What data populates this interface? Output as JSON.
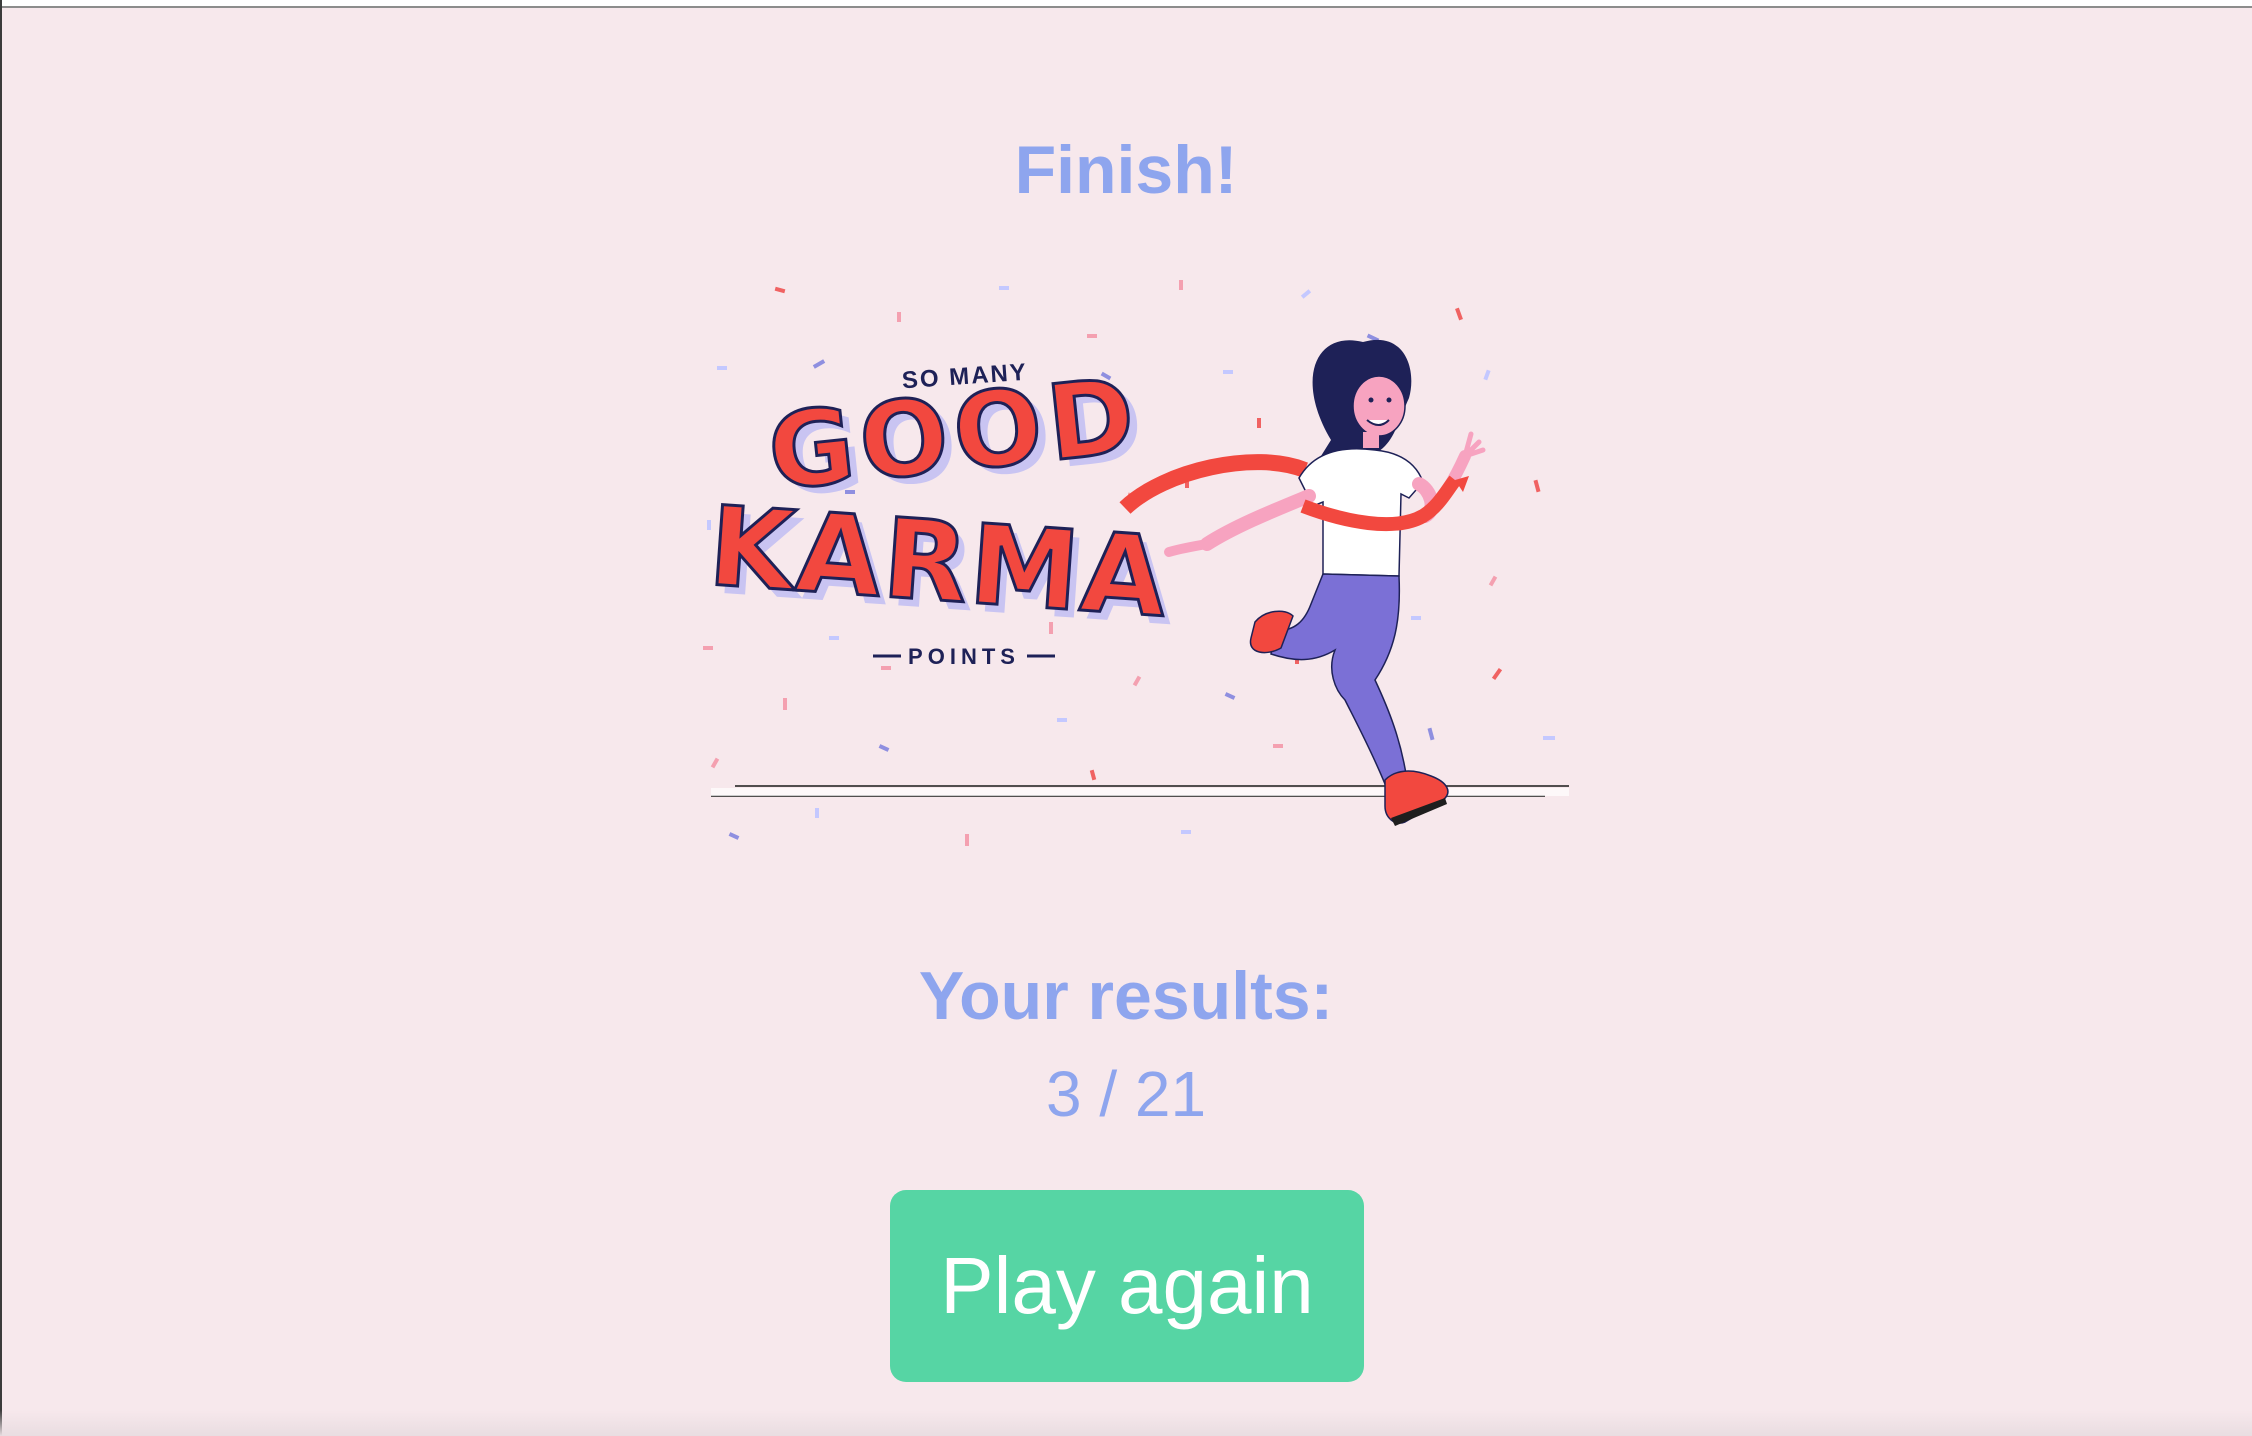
{
  "header": {
    "title": "Finish!"
  },
  "illustration": {
    "badge_top": "SO MANY",
    "badge_line1": "GOOD",
    "badge_line2": "KARMA",
    "badge_bottom": "POINTS"
  },
  "results": {
    "label": "Your results:",
    "score": "3 / 21"
  },
  "actions": {
    "play_again_label": "Play again"
  },
  "colors": {
    "background": "#f7e8ec",
    "heading": "#8ea5ee",
    "button": "#56d5a4",
    "badge_red": "#f2483f",
    "navy": "#1e2157",
    "pants": "#7b70d6"
  }
}
